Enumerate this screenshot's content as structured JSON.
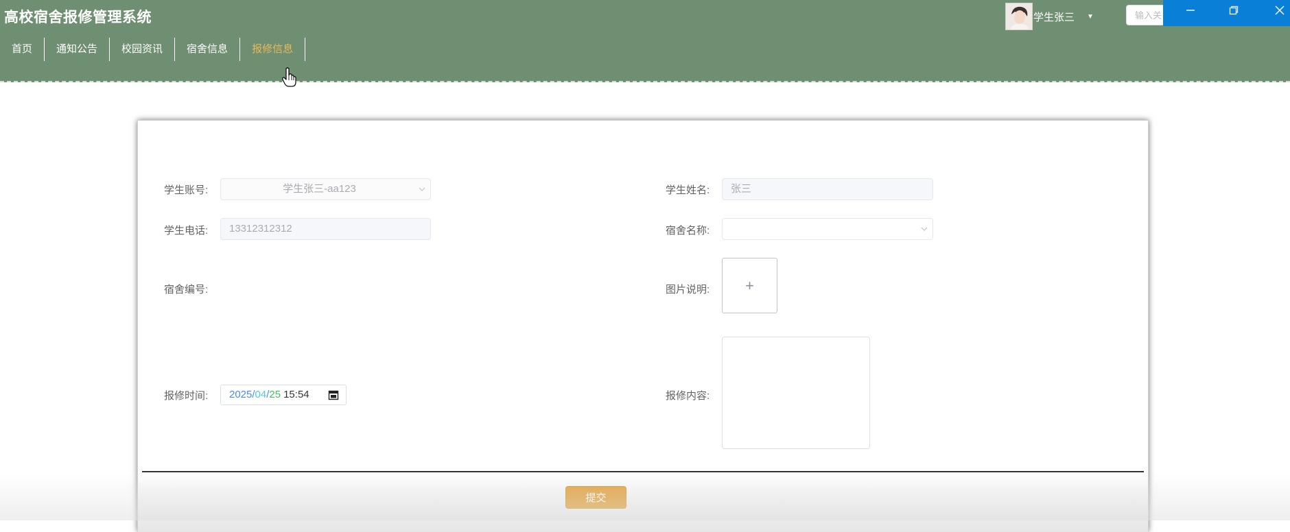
{
  "header": {
    "title": "高校宿舍报修管理系统",
    "nav": [
      {
        "label": "首页",
        "active": false
      },
      {
        "label": "通知公告",
        "active": false
      },
      {
        "label": "校园资讯",
        "active": false
      },
      {
        "label": "宿舍信息",
        "active": false
      },
      {
        "label": "报修信息",
        "active": true
      }
    ],
    "user": {
      "name": "学生张三"
    },
    "search": {
      "placeholder": "输入关"
    },
    "colors": {
      "header_bg": "#6e8f72",
      "active_nav": "#e8b85c",
      "window_bar": "#0a7fd8"
    }
  },
  "form": {
    "student_account": {
      "label": "学生账号:",
      "value": "学生张三-aa123"
    },
    "student_name": {
      "label": "学生姓名:",
      "value": "张三"
    },
    "student_phone": {
      "label": "学生电话:",
      "value": "13312312312"
    },
    "dorm_name": {
      "label": "宿舍名称:",
      "value": ""
    },
    "dorm_number": {
      "label": "宿舍编号:"
    },
    "image_desc": {
      "label": "图片说明:",
      "upload_symbol": "+"
    },
    "repair_time": {
      "label": "报修时间:",
      "year": "2025",
      "month": "04",
      "day": "25",
      "time": "15:54"
    },
    "repair_content": {
      "label": "报修内容:",
      "value": ""
    },
    "submit_label": "提交",
    "colors": {
      "submit_bg": "#e3a545"
    }
  }
}
